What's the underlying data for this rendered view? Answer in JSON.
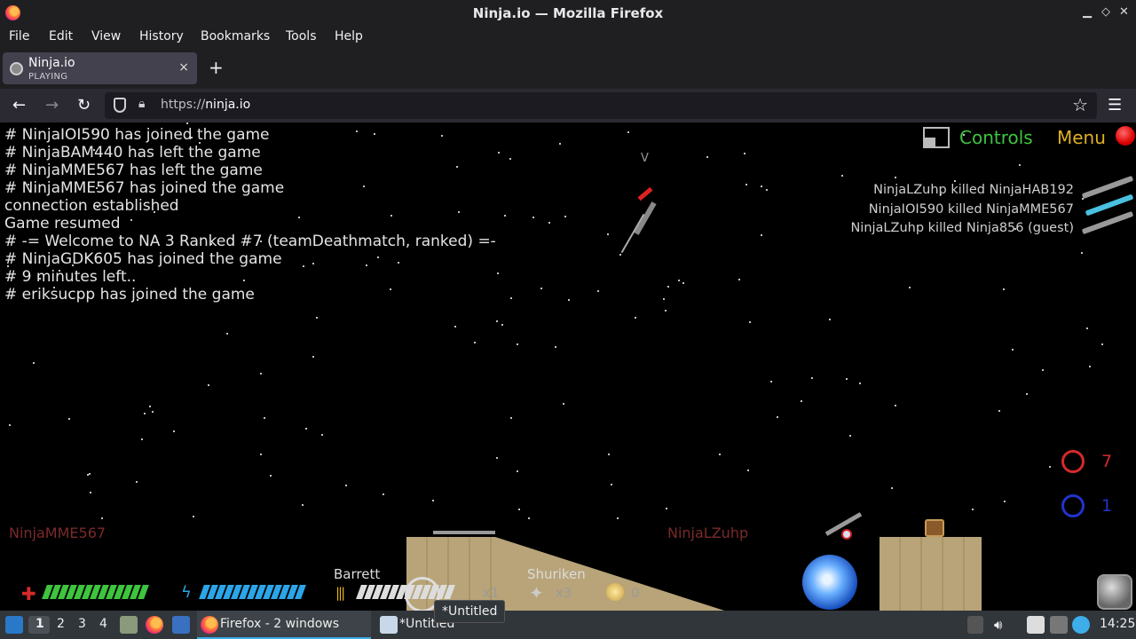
{
  "window": {
    "title": "Ninja.io — Mozilla Firefox"
  },
  "menu": [
    "File",
    "Edit",
    "View",
    "History",
    "Bookmarks",
    "Tools",
    "Help"
  ],
  "tab": {
    "title": "Ninja.io",
    "subtitle": "PLAYING",
    "close": "×",
    "new": "+"
  },
  "nav": {
    "proto": "https://",
    "host": "ninja.io"
  },
  "game": {
    "chat": [
      "# NinjaIOI590 has joined the game",
      "# NinjaBAM440 has left the game",
      "# NinjaMME567 has left the game",
      "# NinjaMME567 has joined the game",
      "connection established",
      "Game resumed",
      "# -= Welcome to NA 3 Ranked #7 (teamDeathmatch, ranked) =-",
      "# NinjaGDK605 has joined the game",
      "# 9 minutes left..",
      "# eriksucpp has joined the game"
    ],
    "controls_label": "Controls",
    "menu_label": "Menu",
    "kill_feed": [
      "NinjaLZuhp killed NinjaHAB192",
      "NinjaIOI590 killed NinjaMME567",
      "NinjaLZuhp killed Ninja856 (guest)"
    ],
    "score_red": "7",
    "score_blue": "1",
    "player_left": "NinjaMME567",
    "player_self": "NinjaLZuhp",
    "marker": "V",
    "hud": {
      "weapon": "Barrett",
      "weapon_count": "x1",
      "throwable": "Shuriken",
      "throwable_count": "x3",
      "coins": "0",
      "health_fraction": 1.0,
      "energy_fraction": 1.0,
      "colors": {
        "health": "#3ec43e",
        "energy": "#2aa6e8",
        "red_team": "#d42a2a",
        "blue_team": "#2233cc",
        "controls": "#3ec43e",
        "menu": "#e0b020"
      }
    }
  },
  "taskbar": {
    "workspaces": [
      "1",
      "2",
      "3",
      "4"
    ],
    "firefox_task": "Firefox - 2 windows",
    "editor_task": "*Untitled",
    "tooltip": "*Untitled",
    "clock": "14:25"
  }
}
